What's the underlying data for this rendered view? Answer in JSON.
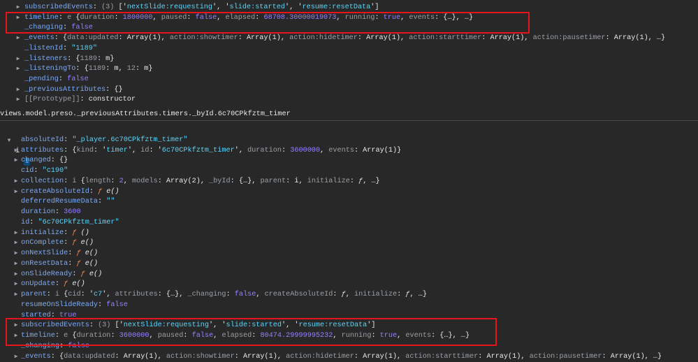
{
  "path_header": "views.model.preso._previousAttributes.timers._byId.6c70CPkfztm_timer",
  "top_rows": [
    {
      "arrow": "right",
      "parts": [
        [
          "k",
          "subscribedEvents"
        ],
        [
          "w",
          ": "
        ],
        [
          "g",
          "(3) "
        ],
        [
          "w",
          "['"
        ],
        [
          "s",
          "nextSlide:requesting"
        ],
        [
          "w",
          "', '"
        ],
        [
          "s",
          "slide:started"
        ],
        [
          "w",
          "', '"
        ],
        [
          "s",
          "resume:resetData"
        ],
        [
          "w",
          "']"
        ]
      ]
    },
    {
      "arrow": "right",
      "parts": [
        [
          "k",
          "timeline"
        ],
        [
          "w",
          ": "
        ],
        [
          "g",
          "e "
        ],
        [
          "w",
          "{"
        ],
        [
          "g",
          "duration"
        ],
        [
          "w",
          ": "
        ],
        [
          "n",
          "1800000"
        ],
        [
          "w",
          ", "
        ],
        [
          "g",
          "paused"
        ],
        [
          "w",
          ": "
        ],
        [
          "n",
          "false"
        ],
        [
          "w",
          ", "
        ],
        [
          "g",
          "elapsed"
        ],
        [
          "w",
          ": "
        ],
        [
          "n",
          "68708.30000019073"
        ],
        [
          "w",
          ", "
        ],
        [
          "g",
          "running"
        ],
        [
          "w",
          ": "
        ],
        [
          "n",
          "true"
        ],
        [
          "w",
          ", "
        ],
        [
          "g",
          "events"
        ],
        [
          "w",
          ": {…}, …}"
        ]
      ]
    },
    {
      "arrow": "",
      "parts": [
        [
          "k",
          "_changing"
        ],
        [
          "w",
          ": "
        ],
        [
          "n",
          "false"
        ]
      ]
    },
    {
      "arrow": "right",
      "parts": [
        [
          "k",
          "_events"
        ],
        [
          "w",
          ": {"
        ],
        [
          "g",
          "data:updated"
        ],
        [
          "w",
          ": Array(1), "
        ],
        [
          "g",
          "action:showtimer"
        ],
        [
          "w",
          ": Array(1), "
        ],
        [
          "g",
          "action:hidetimer"
        ],
        [
          "w",
          ": Array(1), "
        ],
        [
          "g",
          "action:starttimer"
        ],
        [
          "w",
          ": Array(1), "
        ],
        [
          "g",
          "action:pausetimer"
        ],
        [
          "w",
          ": Array(1), …}"
        ]
      ]
    },
    {
      "arrow": "",
      "parts": [
        [
          "k",
          "_listenId"
        ],
        [
          "w",
          ": "
        ],
        [
          "s",
          "\"1189\""
        ]
      ]
    },
    {
      "arrow": "right",
      "parts": [
        [
          "k",
          "_listeners"
        ],
        [
          "w",
          ": {"
        ],
        [
          "g",
          "1189"
        ],
        [
          "w",
          ": m}"
        ]
      ]
    },
    {
      "arrow": "right",
      "parts": [
        [
          "k",
          "_listeningTo"
        ],
        [
          "w",
          ": {"
        ],
        [
          "g",
          "1189"
        ],
        [
          "w",
          ": m, "
        ],
        [
          "g",
          "12"
        ],
        [
          "w",
          ": m}"
        ]
      ]
    },
    {
      "arrow": "",
      "parts": [
        [
          "k",
          "_pending"
        ],
        [
          "w",
          ": "
        ],
        [
          "n",
          "false"
        ]
      ]
    },
    {
      "arrow": "right",
      "parts": [
        [
          "k",
          "_previousAttributes"
        ],
        [
          "w",
          ": {}"
        ]
      ]
    },
    {
      "arrow": "right",
      "parts": [
        [
          "g",
          "[[Prototype]]"
        ],
        [
          "w",
          ": constructor"
        ]
      ]
    }
  ],
  "object_root": {
    "label": "i",
    "badge": "i"
  },
  "bottom_rows": [
    {
      "arrow": "",
      "parts": [
        [
          "k",
          "absoluteId"
        ],
        [
          "w",
          ": "
        ],
        [
          "s",
          "\"_player.6c70CPkfztm_timer\""
        ]
      ]
    },
    {
      "arrow": "right",
      "parts": [
        [
          "k",
          "attributes"
        ],
        [
          "w",
          ": {"
        ],
        [
          "g",
          "kind"
        ],
        [
          "w",
          ": '"
        ],
        [
          "s",
          "timer"
        ],
        [
          "w",
          "', "
        ],
        [
          "g",
          "id"
        ],
        [
          "w",
          ": '"
        ],
        [
          "s",
          "6c70CPkfztm_timer"
        ],
        [
          "w",
          "', "
        ],
        [
          "g",
          "duration"
        ],
        [
          "w",
          ": "
        ],
        [
          "n",
          "3600000"
        ],
        [
          "w",
          ", "
        ],
        [
          "g",
          "events"
        ],
        [
          "w",
          ": Array(1)}"
        ]
      ]
    },
    {
      "arrow": "right",
      "parts": [
        [
          "k",
          "changed"
        ],
        [
          "w",
          ": {}"
        ]
      ]
    },
    {
      "arrow": "",
      "parts": [
        [
          "k",
          "cid"
        ],
        [
          "w",
          ": "
        ],
        [
          "s",
          "\"c190\""
        ]
      ]
    },
    {
      "arrow": "right",
      "parts": [
        [
          "k",
          "collection"
        ],
        [
          "w",
          ": "
        ],
        [
          "g",
          "i "
        ],
        [
          "w",
          "{"
        ],
        [
          "g",
          "length"
        ],
        [
          "w",
          ": "
        ],
        [
          "n",
          "2"
        ],
        [
          "w",
          ", "
        ],
        [
          "g",
          "models"
        ],
        [
          "w",
          ": Array(2), "
        ],
        [
          "g",
          "_byId"
        ],
        [
          "w",
          ": {…}, "
        ],
        [
          "g",
          "parent"
        ],
        [
          "w",
          ": i, "
        ],
        [
          "g",
          "initialize"
        ],
        [
          "w",
          ": "
        ],
        [
          "fi",
          "ƒ"
        ],
        [
          "w",
          ", …}"
        ]
      ]
    },
    {
      "arrow": "right",
      "parts": [
        [
          "k",
          "createAbsoluteId"
        ],
        [
          "w",
          ": "
        ],
        [
          "f",
          "ƒ "
        ],
        [
          "fi",
          "e()"
        ]
      ]
    },
    {
      "arrow": "",
      "parts": [
        [
          "k",
          "deferredResumeData"
        ],
        [
          "w",
          ": "
        ],
        [
          "s",
          "\"\""
        ]
      ]
    },
    {
      "arrow": "",
      "parts": [
        [
          "k",
          "duration"
        ],
        [
          "w",
          ": "
        ],
        [
          "n",
          "3600"
        ]
      ]
    },
    {
      "arrow": "",
      "parts": [
        [
          "k",
          "id"
        ],
        [
          "w",
          ": "
        ],
        [
          "s",
          "\"6c70CPkfztm_timer\""
        ]
      ]
    },
    {
      "arrow": "right",
      "parts": [
        [
          "k",
          "initialize"
        ],
        [
          "w",
          ": "
        ],
        [
          "f",
          "ƒ "
        ],
        [
          "fi",
          "()"
        ]
      ]
    },
    {
      "arrow": "right",
      "parts": [
        [
          "k",
          "onComplete"
        ],
        [
          "w",
          ": "
        ],
        [
          "f",
          "ƒ "
        ],
        [
          "fi",
          "e()"
        ]
      ]
    },
    {
      "arrow": "right",
      "parts": [
        [
          "k",
          "onNextSlide"
        ],
        [
          "w",
          ": "
        ],
        [
          "f",
          "ƒ "
        ],
        [
          "fi",
          "e()"
        ]
      ]
    },
    {
      "arrow": "right",
      "parts": [
        [
          "k",
          "onResetData"
        ],
        [
          "w",
          ": "
        ],
        [
          "f",
          "ƒ "
        ],
        [
          "fi",
          "e()"
        ]
      ]
    },
    {
      "arrow": "right",
      "parts": [
        [
          "k",
          "onSlideReady"
        ],
        [
          "w",
          ": "
        ],
        [
          "f",
          "ƒ "
        ],
        [
          "fi",
          "e()"
        ]
      ]
    },
    {
      "arrow": "right",
      "parts": [
        [
          "k",
          "onUpdate"
        ],
        [
          "w",
          ": "
        ],
        [
          "f",
          "ƒ "
        ],
        [
          "fi",
          "e()"
        ]
      ]
    },
    {
      "arrow": "right",
      "parts": [
        [
          "k",
          "parent"
        ],
        [
          "w",
          ": "
        ],
        [
          "g",
          "i "
        ],
        [
          "w",
          "{"
        ],
        [
          "g",
          "cid"
        ],
        [
          "w",
          ": '"
        ],
        [
          "s",
          "c7"
        ],
        [
          "w",
          "', "
        ],
        [
          "g",
          "attributes"
        ],
        [
          "w",
          ": {…}, "
        ],
        [
          "g",
          "_changing"
        ],
        [
          "w",
          ": "
        ],
        [
          "n",
          "false"
        ],
        [
          "w",
          ", "
        ],
        [
          "g",
          "createAbsoluteId"
        ],
        [
          "w",
          ": "
        ],
        [
          "fi",
          "ƒ"
        ],
        [
          "w",
          ", "
        ],
        [
          "g",
          "initialize"
        ],
        [
          "w",
          ": "
        ],
        [
          "fi",
          "ƒ"
        ],
        [
          "w",
          ", …}"
        ]
      ]
    },
    {
      "arrow": "",
      "parts": [
        [
          "k",
          "resumeOnSlideReady"
        ],
        [
          "w",
          ": "
        ],
        [
          "n",
          "false"
        ]
      ]
    },
    {
      "arrow": "",
      "parts": [
        [
          "k",
          "started"
        ],
        [
          "w",
          ": "
        ],
        [
          "n",
          "true"
        ]
      ]
    },
    {
      "arrow": "right",
      "parts": [
        [
          "k",
          "subscribedEvents"
        ],
        [
          "w",
          ": "
        ],
        [
          "g",
          "(3) "
        ],
        [
          "w",
          "['"
        ],
        [
          "s",
          "nextSlide:requesting"
        ],
        [
          "w",
          "', '"
        ],
        [
          "s",
          "slide:started"
        ],
        [
          "w",
          "', '"
        ],
        [
          "s",
          "resume:resetData"
        ],
        [
          "w",
          "']"
        ]
      ]
    },
    {
      "arrow": "right",
      "parts": [
        [
          "k",
          "timeline"
        ],
        [
          "w",
          ": "
        ],
        [
          "g",
          "e "
        ],
        [
          "w",
          "{"
        ],
        [
          "g",
          "duration"
        ],
        [
          "w",
          ": "
        ],
        [
          "n",
          "3600000"
        ],
        [
          "w",
          ", "
        ],
        [
          "g",
          "paused"
        ],
        [
          "w",
          ": "
        ],
        [
          "n",
          "false"
        ],
        [
          "w",
          ", "
        ],
        [
          "g",
          "elapsed"
        ],
        [
          "w",
          ": "
        ],
        [
          "n",
          "80474.29999995232"
        ],
        [
          "w",
          ", "
        ],
        [
          "g",
          "running"
        ],
        [
          "w",
          ": "
        ],
        [
          "n",
          "true"
        ],
        [
          "w",
          ", "
        ],
        [
          "g",
          "events"
        ],
        [
          "w",
          ": {…}, …}"
        ]
      ]
    },
    {
      "arrow": "",
      "parts": [
        [
          "k",
          "_changing"
        ],
        [
          "w",
          ": "
        ],
        [
          "n",
          "false"
        ]
      ]
    },
    {
      "arrow": "right",
      "parts": [
        [
          "k",
          "_events"
        ],
        [
          "w",
          ": {"
        ],
        [
          "g",
          "data:updated"
        ],
        [
          "w",
          ": Array(1), "
        ],
        [
          "g",
          "action:showtimer"
        ],
        [
          "w",
          ": Array(1), "
        ],
        [
          "g",
          "action:hidetimer"
        ],
        [
          "w",
          ": Array(1), "
        ],
        [
          "g",
          "action:starttimer"
        ],
        [
          "w",
          ": Array(1), "
        ],
        [
          "g",
          "action:pausetimer"
        ],
        [
          "w",
          ": Array(1), …}"
        ]
      ]
    }
  ],
  "colors": {
    "highlight": "#e8141b",
    "background": "#282828"
  }
}
